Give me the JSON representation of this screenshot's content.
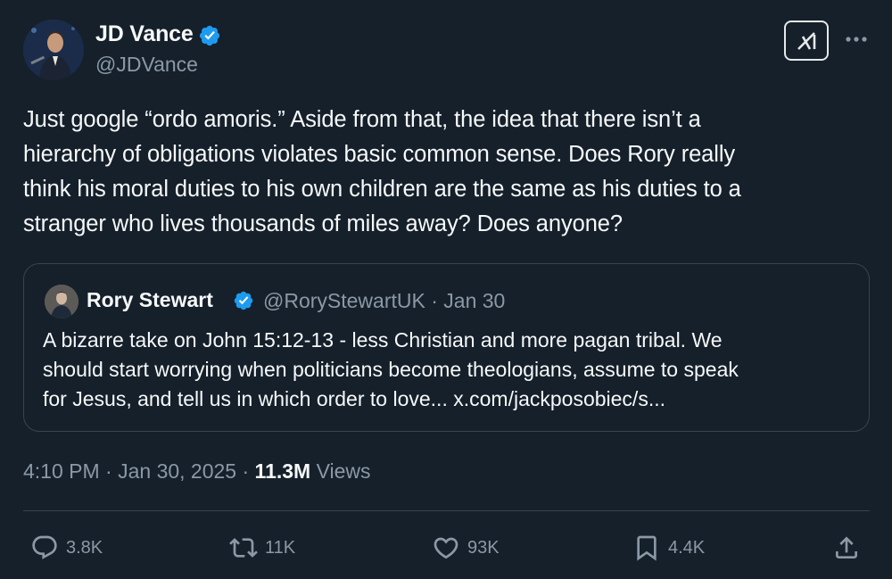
{
  "author": {
    "name": "JD Vance",
    "handle": "@JDVance",
    "verified_color": "#1d9bf0"
  },
  "tweet": {
    "text": "Just google “ordo amoris.” Aside from that, the idea that there isn’t a\nhierarchy of obligations violates basic common sense. Does Rory really\nthink his moral duties to his own children are the same as his duties to a\nstranger who lives thousands of miles away? Does anyone?"
  },
  "quote": {
    "name": "Rory Stewart",
    "handle_date": "@RoryStewartUK · Jan 30",
    "text": "A bizarre take on John 15:12-13  - less Christian and more pagan tribal. We\nshould start worrying when politicians become theologians, assume to speak\nfor Jesus, and tell us in which order to love... x.com/jackposobiec/s..."
  },
  "meta": {
    "time_date": "4:10 PM · Jan 30, 2025 · ",
    "views_count": "11.3M",
    "views_label": " Views"
  },
  "actions": {
    "replies": "3.8K",
    "reposts": "11K",
    "likes": "93K",
    "bookmarks": "4.4K"
  },
  "icons": [
    "grok-icon",
    "more-icon",
    "verified-badge-icon",
    "reply-icon",
    "repost-icon",
    "like-icon",
    "bookmark-icon",
    "share-icon"
  ],
  "colors": {
    "background": "#15202b",
    "text": "#f7f9f9",
    "secondary": "#8b98a5",
    "border": "#38444d"
  }
}
